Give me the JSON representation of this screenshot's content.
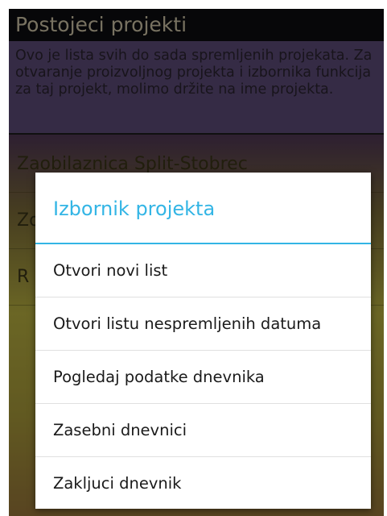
{
  "header": {
    "title": "Postojeci projekti"
  },
  "description": "Ovo je lista svih do sada spremljenih projekata. Za otvaranje proizvoljnog projekta i izbornika funkcija za taj projekt, molimo držite na ime projekta.",
  "projects": [
    {
      "name": "Zaobilaznica Split-Stobrec"
    },
    {
      "name": "Zo"
    },
    {
      "name": "R"
    }
  ],
  "dialog": {
    "title": "Izbornik projekta",
    "items": [
      {
        "label": "Otvori novi list"
      },
      {
        "label": "Otvori listu nespremljenih datuma"
      },
      {
        "label": "Pogledaj podatke dnevnika"
      },
      {
        "label": "Zasebni dnevnici"
      },
      {
        "label": "Zakljuci dnevnik"
      }
    ]
  },
  "colors": {
    "accent": "#33b5e5",
    "title_bar": "#0d0d10"
  }
}
